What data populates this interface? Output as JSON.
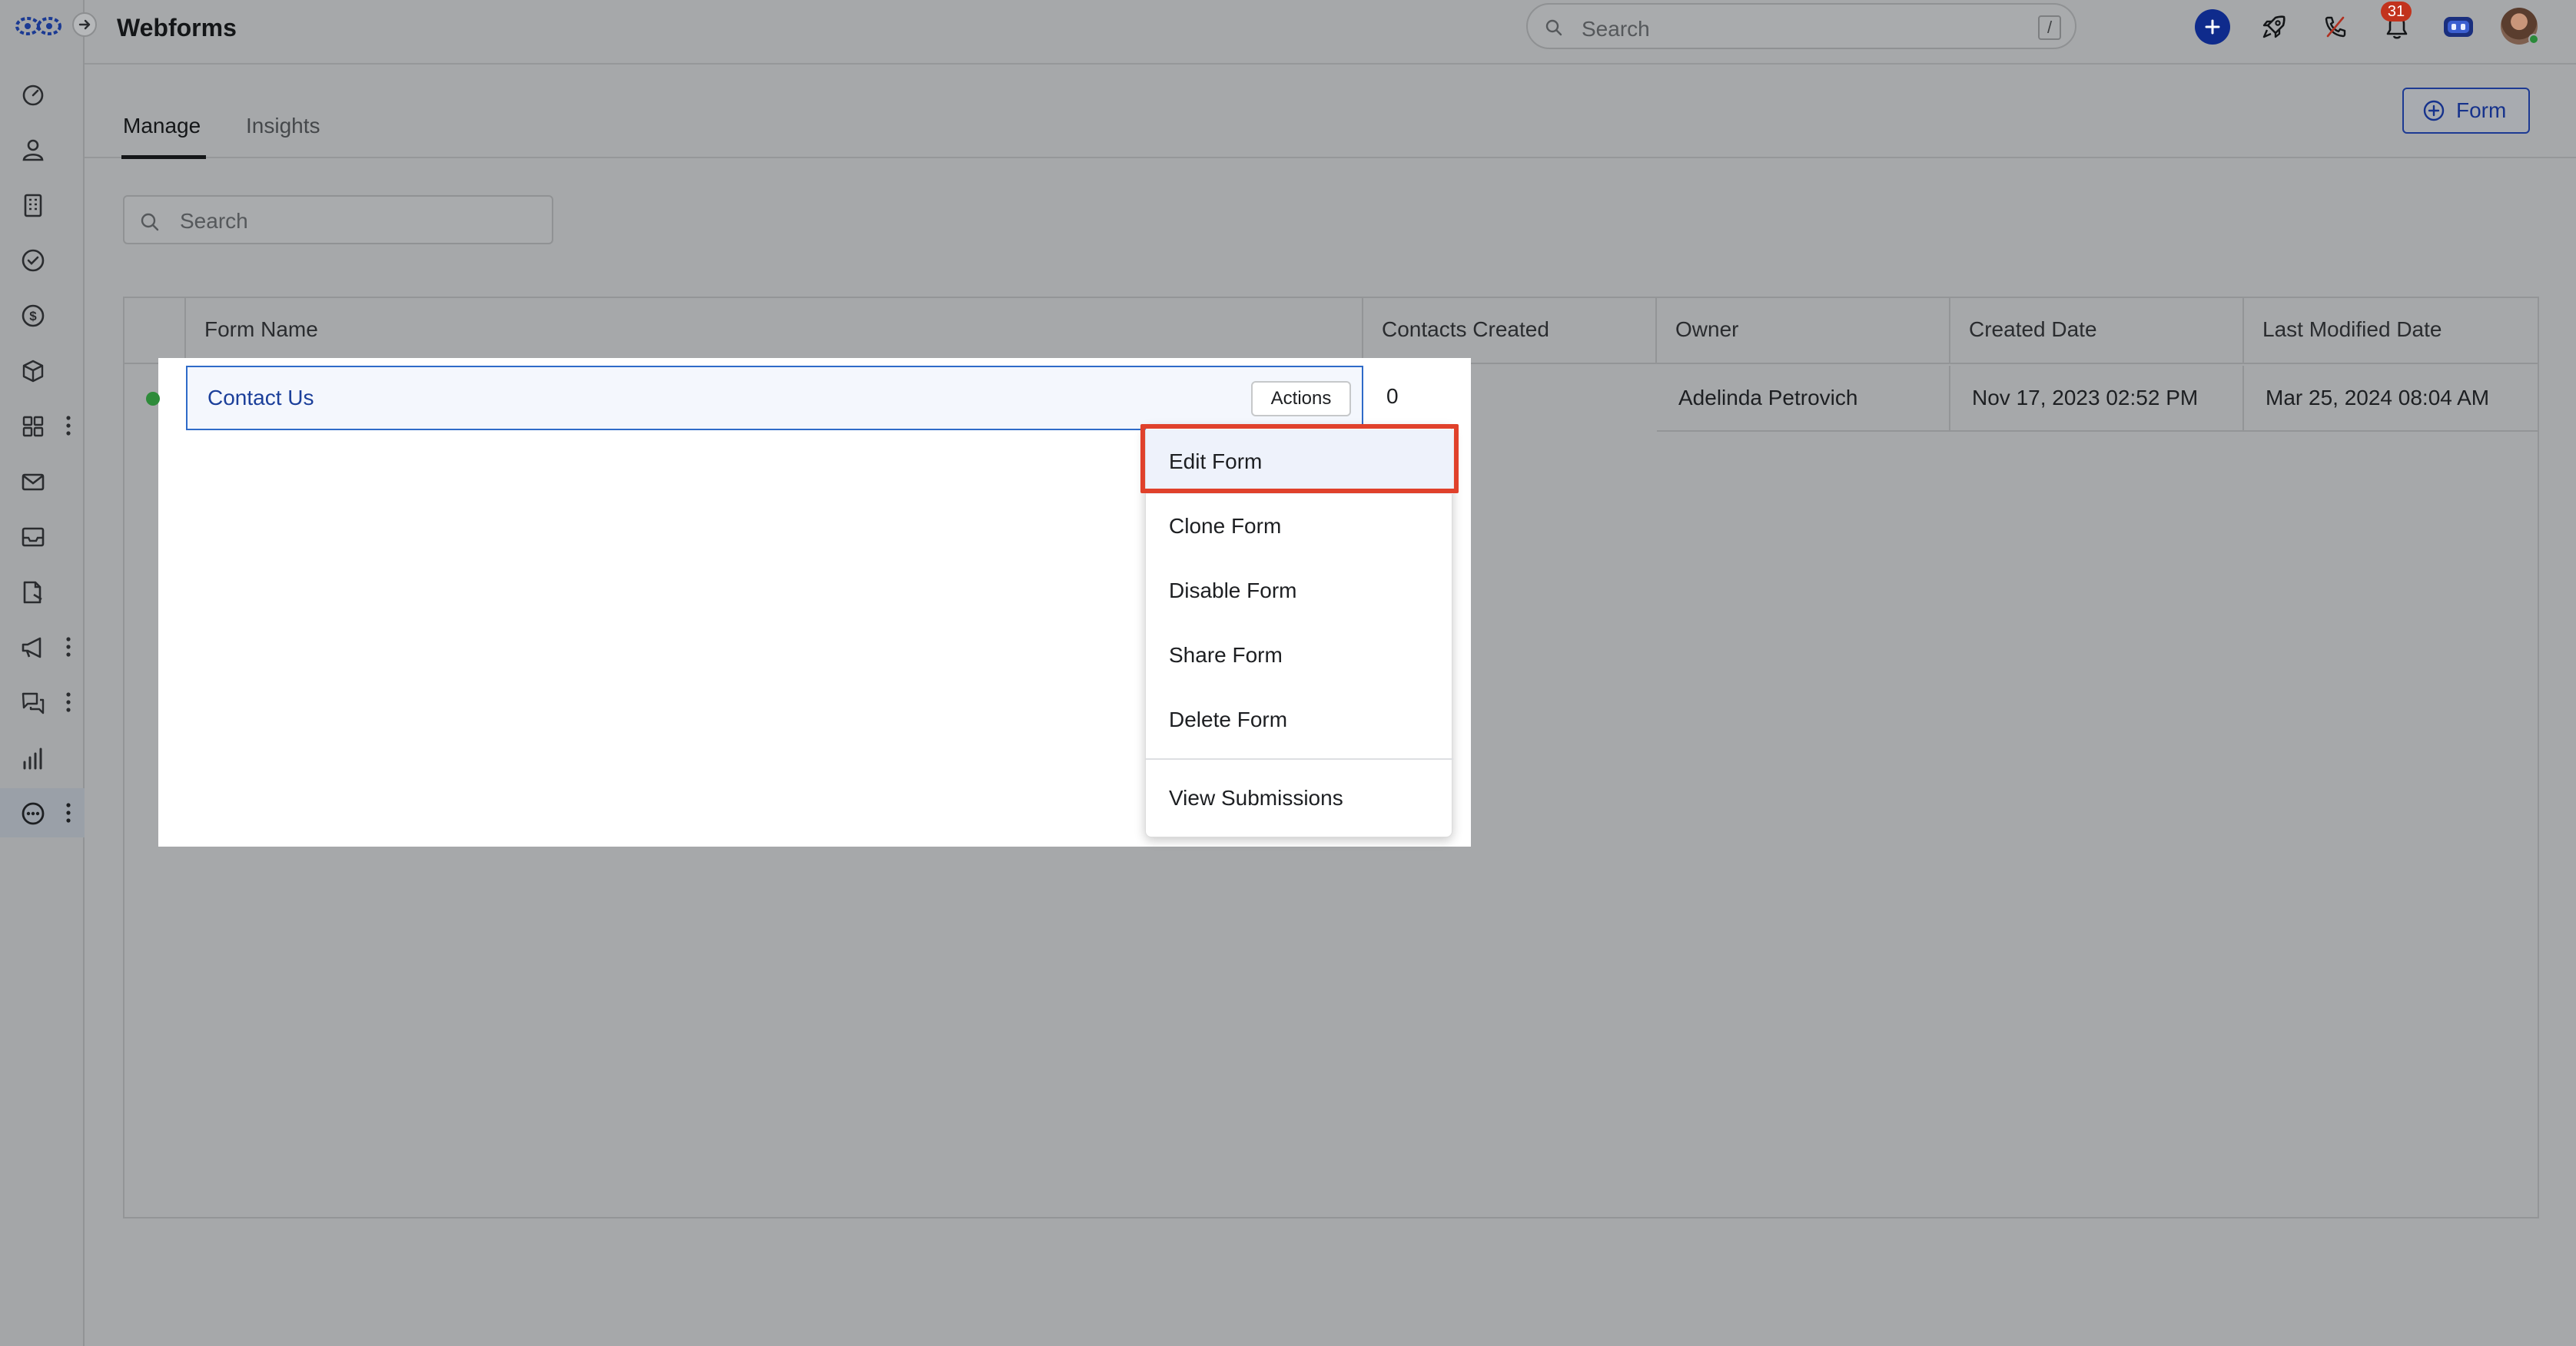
{
  "app": {
    "title": "Webforms"
  },
  "topbar": {
    "search_placeholder": "Search",
    "search_shortcut": "/",
    "notification_count": "31"
  },
  "sidebar": {
    "items": [
      {
        "icon": "dashboard-icon"
      },
      {
        "icon": "contacts-icon"
      },
      {
        "icon": "companies-icon"
      },
      {
        "icon": "tasks-icon"
      },
      {
        "icon": "deals-icon"
      },
      {
        "icon": "products-icon"
      },
      {
        "icon": "apps-icon",
        "has_menu": true
      },
      {
        "icon": "mail-icon"
      },
      {
        "icon": "inbox-icon"
      },
      {
        "icon": "documents-icon"
      },
      {
        "icon": "campaigns-icon",
        "has_menu": true
      },
      {
        "icon": "chat-icon",
        "has_menu": true
      },
      {
        "icon": "reports-icon"
      },
      {
        "icon": "more-icon",
        "has_menu": true,
        "active": true
      }
    ]
  },
  "tabs": [
    {
      "label": "Manage",
      "active": true
    },
    {
      "label": "Insights",
      "active": false
    }
  ],
  "add_button": {
    "label": "Form"
  },
  "list_search": {
    "placeholder": "Search"
  },
  "table": {
    "columns": [
      "Form Name",
      "Contacts Created",
      "Owner",
      "Created Date",
      "Last Modified Date"
    ],
    "rows": [
      {
        "name": "Contact Us",
        "contacts_created": "0",
        "owner": "Adelinda Petrovich",
        "created_date": "Nov 17, 2023 02:52 PM",
        "last_modified": "Mar 25, 2024 08:04 AM",
        "status": "active"
      }
    ],
    "row_action_label": "Actions"
  },
  "actions_menu": {
    "items": [
      "Edit Form",
      "Clone Form",
      "Disable Form",
      "Share Form",
      "Delete Form",
      "View Submissions"
    ],
    "highlighted": "Edit Form"
  },
  "colors": {
    "accent": "#16328c",
    "highlight": "#e0412b",
    "status_active": "#2e8b3a",
    "link": "#1b3f9a"
  }
}
